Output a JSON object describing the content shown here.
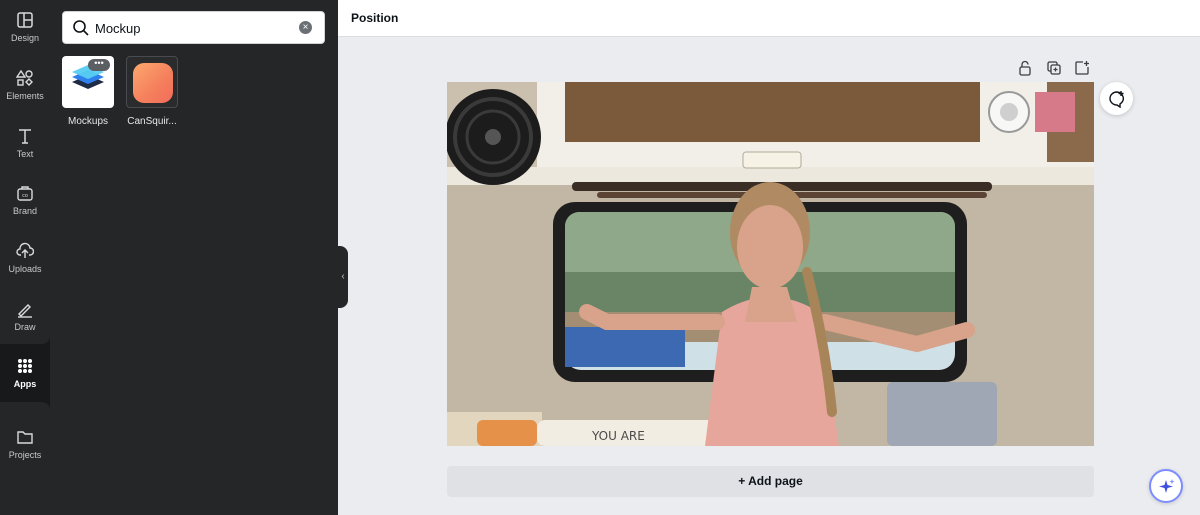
{
  "sidebar": {
    "items": [
      {
        "label": "Design",
        "icon": "design-icon"
      },
      {
        "label": "Elements",
        "icon": "elements-icon"
      },
      {
        "label": "Text",
        "icon": "text-icon"
      },
      {
        "label": "Brand",
        "icon": "brand-icon"
      },
      {
        "label": "Uploads",
        "icon": "upload-icon"
      },
      {
        "label": "Draw",
        "icon": "draw-icon"
      },
      {
        "label": "Apps",
        "icon": "apps-icon",
        "active": true
      },
      {
        "label": "Projects",
        "icon": "folder-icon"
      }
    ]
  },
  "search": {
    "value": "Mockup",
    "placeholder": "Search"
  },
  "apps": [
    {
      "name": "Mockups",
      "icon": "mockups-layers-icon"
    },
    {
      "name": "CanSquir...",
      "icon": "cansquircle-icon"
    }
  ],
  "topbar": {
    "position_label": "Position"
  },
  "canvas": {
    "add_page_label": "+ Add page",
    "toolbar_icons": [
      "lock-icon",
      "duplicate-icon",
      "add-page-icon"
    ],
    "comment_icon": "add-comment-icon",
    "magic_icon": "sparkle-icon"
  },
  "colors": {
    "rail_bg": "#18191b",
    "panel_bg": "#252627",
    "canvas_bg": "#ebecf0",
    "accent": "#7d8dff"
  }
}
